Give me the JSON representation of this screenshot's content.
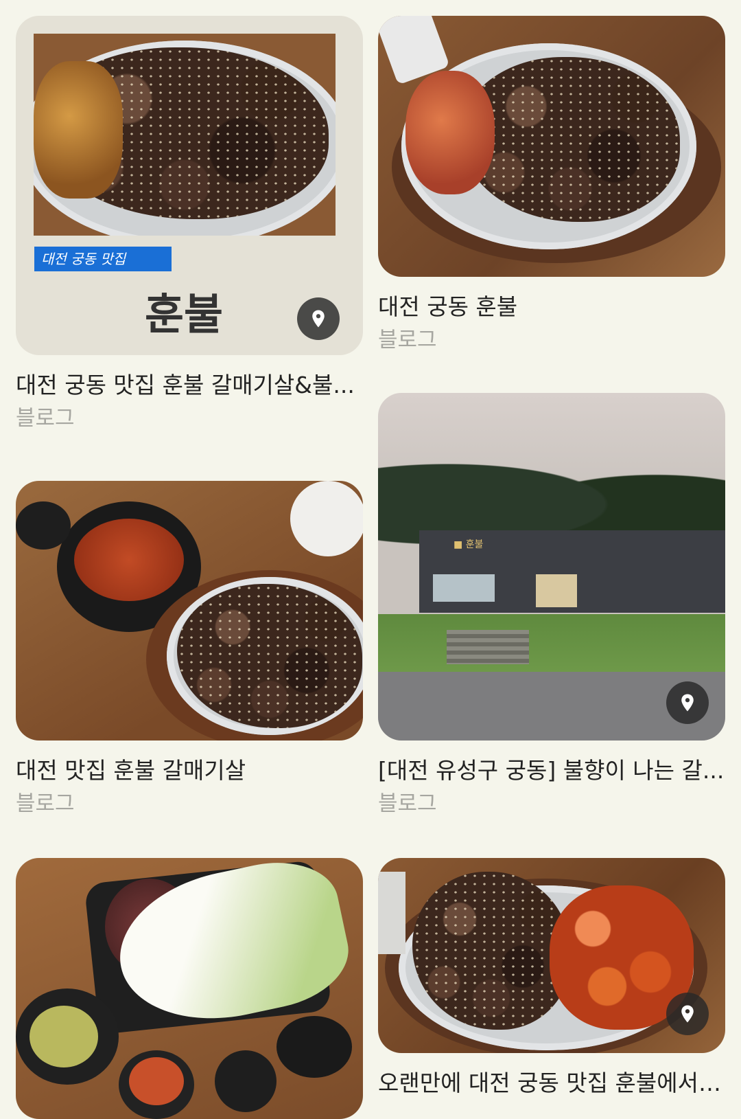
{
  "results": [
    {
      "title": "대전 궁동 맛집 훈불 갈매기살&불...",
      "source": "블로그",
      "banner": "대전 궁동 맛집",
      "name_overlay": "훈불",
      "has_pin": true
    },
    {
      "title": "대전 궁동 훈불",
      "source": "블로그",
      "has_pin": false
    },
    {
      "title": "대전 맛집 훈불 갈매기살",
      "source": "블로그",
      "has_pin": false
    },
    {
      "title": "[대전 유성구 궁동] 불향이 나는 갈...",
      "source": "블로그",
      "has_pin": true
    },
    {
      "title": "",
      "source": "",
      "has_pin": false
    },
    {
      "title": "오랜만에 대전 궁동 맛집 훈불에서 ...",
      "source": "",
      "has_pin": true
    }
  ],
  "icons": {
    "pin": "location-pin-icon"
  }
}
